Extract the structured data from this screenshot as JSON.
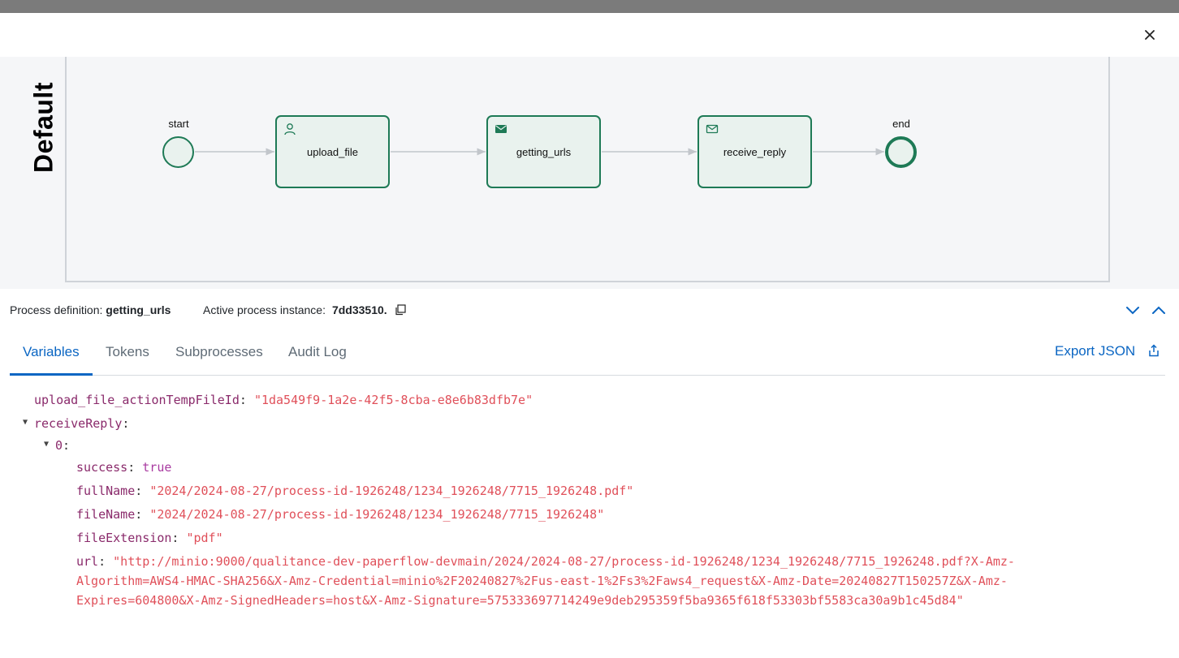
{
  "diagram": {
    "lane": "Default",
    "start_label": "start",
    "end_label": "end",
    "tasks": [
      {
        "label": "upload_file",
        "icon": "user-icon"
      },
      {
        "label": "getting_urls",
        "icon": "envelope-filled-icon"
      },
      {
        "label": "receive_reply",
        "icon": "envelope-outline-icon"
      }
    ],
    "colors": {
      "accent": "#1e7a56",
      "fill": "#e9f2ee"
    }
  },
  "info": {
    "definition_label": "Process definition:",
    "definition_value": "getting_urls",
    "instance_label": "Active process instance:",
    "instance_value": "7dd33510."
  },
  "tabs": [
    "Variables",
    "Tokens",
    "Subprocesses",
    "Audit Log"
  ],
  "export_label": "Export JSON",
  "vars": {
    "upload_key": "upload_file_actionTempFileId",
    "upload_val": "\"1da549f9-1a2e-42f5-8cba-e8e6b83dfb7e\"",
    "reply_key": "receiveReply",
    "index_key": "0",
    "success_key": "success",
    "success_val": "true",
    "fullname_key": "fullName",
    "fullname_val": "\"2024/2024-08-27/process-id-1926248/1234_1926248/7715_1926248.pdf\"",
    "filename_key": "fileName",
    "filename_val": "\"2024/2024-08-27/process-id-1926248/1234_1926248/7715_1926248\"",
    "ext_key": "fileExtension",
    "ext_val": "\"pdf\"",
    "url_key": "url",
    "url_line1": "\"http://minio:9000/qualitance-dev-paperflow-devmain/2024/2024-08-27/process-id-1926248/1234_1926248/7715_1926248.pdf?X-Amz-",
    "url_line2": "Algorithm=AWS4-HMAC-SHA256&X-Amz-Credential=minio%2F20240827%2Fus-east-1%2Fs3%2Faws4_request&X-Amz-Date=20240827T150257Z&X-Amz-",
    "url_line3": "Expires=604800&X-Amz-SignedHeaders=host&X-Amz-Signature=575333697714249e9deb295359f5ba9365f618f53303bf5583ca30a9b1c45d84\""
  }
}
